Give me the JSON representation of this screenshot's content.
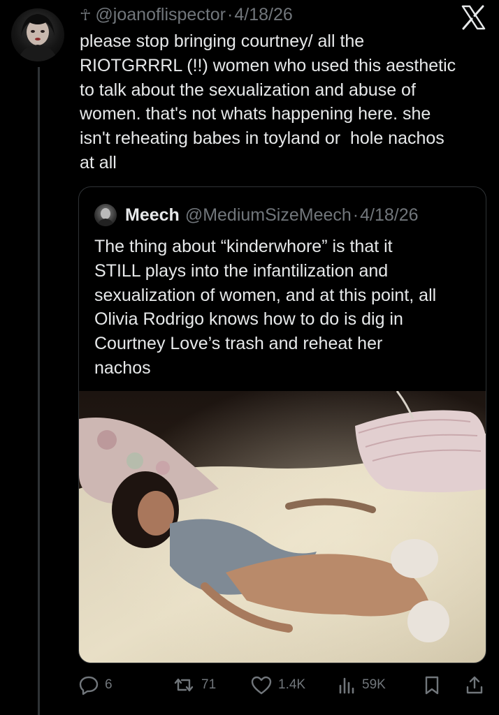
{
  "tweet": {
    "author_handle": "@joanoflispector",
    "separator": "·",
    "date": "4/18/26",
    "ankh": "☥",
    "text": "please stop bringing courtney/ all the\nRIOTGRRRL (!!) women who used this aesthetic\nto talk about the sexualization and abuse of\nwomen. that's not whats happening here. she\nisn't reheating babes in toyland or  hole nachos\nat all"
  },
  "quote": {
    "name": "Meech",
    "handle": "@MediumSizeMeech",
    "separator": "·",
    "date": "4/18/26",
    "text": "The thing about “kinderwhore” is that it\nSTILL plays into the infantilization and\nsexualization of women, and at this point, all\nOlivia Rodrigo knows how to do is dig in\nCourtney Love’s trash and reheat her\nnachos"
  },
  "actions": {
    "replies": "6",
    "reposts": "71",
    "likes": "1.4K",
    "views": "59K"
  },
  "icons": [
    "x-logo-icon",
    "reply-icon",
    "repost-icon",
    "like-icon",
    "views-icon",
    "bookmark-icon",
    "share-icon"
  ],
  "colors": {
    "background": "#000000",
    "text": "#e7e9ea",
    "muted": "#71767b",
    "border": "#2f3336"
  }
}
